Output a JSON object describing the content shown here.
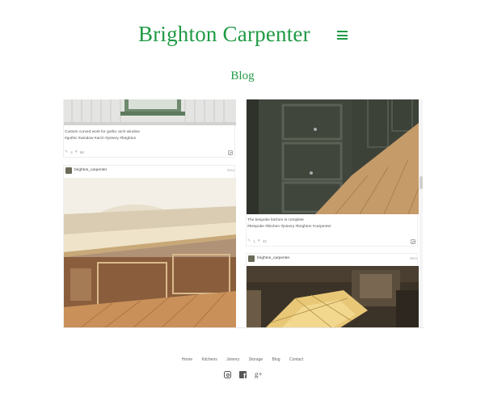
{
  "header": {
    "site_title": "Brighton Carpenter",
    "menu_icon": "hamburger-menu-icon"
  },
  "page": {
    "heading": "Blog"
  },
  "feed": {
    "left": [
      {
        "caption_line1": "Custom curved work for gothic arch window",
        "caption_line2": "#gothic #window #arch #joinery #brighton",
        "comments": "4",
        "likes": "58"
      },
      {
        "username": "brighton_carpenter",
        "time": "5mo"
      }
    ],
    "right": [
      {
        "caption_line1": "The bespoke kitchen is complete",
        "caption_line2": "#bespoke #kitchen #joinery #brighton #carpenter",
        "comments": "1",
        "likes": "42"
      },
      {
        "username": "brighton_carpenter",
        "time": "6mo"
      }
    ]
  },
  "footer": {
    "nav": [
      "Home",
      "Kitchens",
      "Joinery",
      "Storage",
      "Blog",
      "Contact"
    ],
    "social": [
      "instagram-icon",
      "facebook-icon",
      "google-plus-icon"
    ],
    "gplus_glyph": "g+"
  },
  "colors": {
    "brand_green": "#1f9a44"
  }
}
